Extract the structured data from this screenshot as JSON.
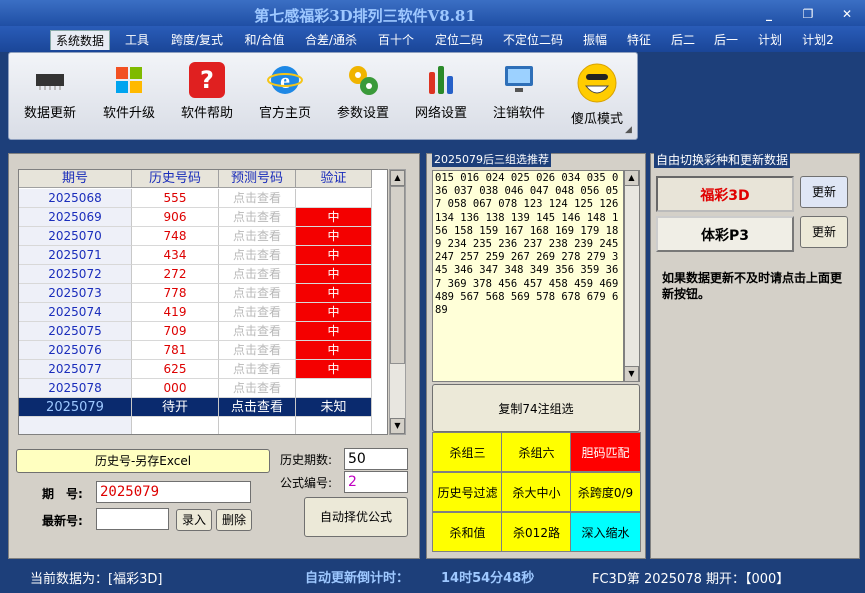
{
  "window": {
    "title": "第七感福彩3D排列三软件V8.81",
    "minimize": "_",
    "restore": "❐",
    "close": "✕"
  },
  "menu": [
    "系统数据",
    "工具",
    "跨度/复式",
    "和/合值",
    "合差/通杀",
    "百十个",
    "定位二码",
    "不定位二码",
    "振幅",
    "特征",
    "后二",
    "后一",
    "计划",
    "计划2"
  ],
  "toolbar": [
    {
      "label": "数据更新",
      "icon": "chip-icon"
    },
    {
      "label": "软件升级",
      "icon": "windows-icon"
    },
    {
      "label": "软件帮助",
      "icon": "help-icon"
    },
    {
      "label": "官方主页",
      "icon": "ie-icon"
    },
    {
      "label": "参数设置",
      "icon": "gears-icon"
    },
    {
      "label": "网络设置",
      "icon": "bars-icon"
    },
    {
      "label": "注销软件",
      "icon": "monitor-icon"
    },
    {
      "label": "傻瓜模式",
      "icon": "smiley-icon"
    }
  ],
  "grid": {
    "headers": [
      "期号",
      "历史号码",
      "预测号码",
      "验证"
    ],
    "rows": [
      {
        "issue": "2025068",
        "hist": "555",
        "pred": "点击查看",
        "verify": ""
      },
      {
        "issue": "2025069",
        "hist": "906",
        "pred": "点击查看",
        "verify": "中"
      },
      {
        "issue": "2025070",
        "hist": "748",
        "pred": "点击查看",
        "verify": "中"
      },
      {
        "issue": "2025071",
        "hist": "434",
        "pred": "点击查看",
        "verify": "中"
      },
      {
        "issue": "2025072",
        "hist": "272",
        "pred": "点击查看",
        "verify": "中"
      },
      {
        "issue": "2025073",
        "hist": "778",
        "pred": "点击查看",
        "verify": "中"
      },
      {
        "issue": "2025074",
        "hist": "419",
        "pred": "点击查看",
        "verify": "中"
      },
      {
        "issue": "2025075",
        "hist": "709",
        "pred": "点击查看",
        "verify": "中"
      },
      {
        "issue": "2025076",
        "hist": "781",
        "pred": "点击查看",
        "verify": "中"
      },
      {
        "issue": "2025077",
        "hist": "625",
        "pred": "点击查看",
        "verify": "中"
      },
      {
        "issue": "2025078",
        "hist": "000",
        "pred": "点击查看",
        "verify": ""
      },
      {
        "issue": "2025079",
        "hist": "待开",
        "pred": "点击查看",
        "verify": "未知"
      }
    ]
  },
  "left": {
    "export_label": "历史号-另存Excel",
    "issue_label": "期　号:",
    "issue_value": "2025079",
    "latest_label": "最新号:",
    "latest_value": "",
    "enter_label": "录入",
    "delete_label": "删除",
    "hist_count_label": "历史期数:",
    "hist_count_value": "50",
    "formula_label": "公式编号:",
    "formula_value": "2",
    "auto_label": "自动择优公式"
  },
  "mid": {
    "group_title": "2025079后三组选推荐",
    "numbers": "015 016 024 025 026 034 035 036 037 038 046 047 048 056 057 058 067 078 123 124 125 126 134 136 138 139 145 146 148 156 158 159 167 168 169 179 189 234 235 236 237 238 239 245 247 257 259 267 269 278 279 345 346 347 348 349 356 359 367 369 378 456 457 458 459 469 489 567 568 569 578 678 679 689",
    "copy_label": "复制74注组选",
    "buttons": [
      {
        "label": "杀组三",
        "style": "yel"
      },
      {
        "label": "杀组六",
        "style": "yel"
      },
      {
        "label": "胆码匹配",
        "style": "redb"
      },
      {
        "label": "历史号过滤",
        "style": "yel"
      },
      {
        "label": "杀大中小",
        "style": "yel"
      },
      {
        "label": "杀跨度0/9",
        "style": "yel"
      },
      {
        "label": "杀和值",
        "style": "yel"
      },
      {
        "label": "杀012路",
        "style": "yel"
      },
      {
        "label": "深入缩水",
        "style": "cyan"
      }
    ]
  },
  "right": {
    "group_title": "自由切换彩种和更新数据",
    "lottery1": "福彩3D",
    "lottery2": "体彩P3",
    "update1": "更新",
    "update2": "更新",
    "note": "如果数据更新不及时请点击上面更新按钮。"
  },
  "status": {
    "current": "当前数据为：[福彩3D]",
    "countdown_label": "自动更新倒计时：",
    "countdown_value": "14时54分48秒",
    "draw": "FC3D第 2025078 期开：【000】"
  }
}
